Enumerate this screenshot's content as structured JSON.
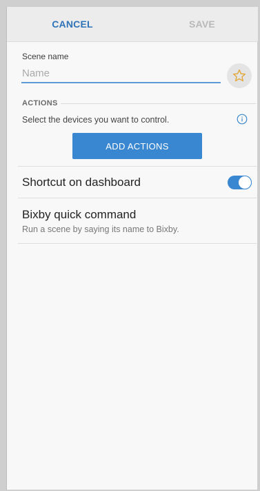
{
  "appbar": {
    "cancel_label": "CANCEL",
    "save_label": "SAVE"
  },
  "scene_name": {
    "label": "Scene name",
    "value": "",
    "placeholder": "Name",
    "favorite_icon": "star-outline-icon"
  },
  "actions": {
    "header": "ACTIONS",
    "description": "Select the devices you want to control.",
    "info_icon": "info-icon",
    "add_button": "ADD ACTIONS"
  },
  "shortcut": {
    "label": "Shortcut on dashboard",
    "enabled": true
  },
  "bixby": {
    "title": "Bixby quick command",
    "subtitle": "Run a scene by saying its name to Bixby."
  },
  "colors": {
    "accent": "#3a87d1",
    "cancel_text": "#2e72b8",
    "save_text_disabled": "#b9b9b9",
    "star": "#e2a32b"
  }
}
